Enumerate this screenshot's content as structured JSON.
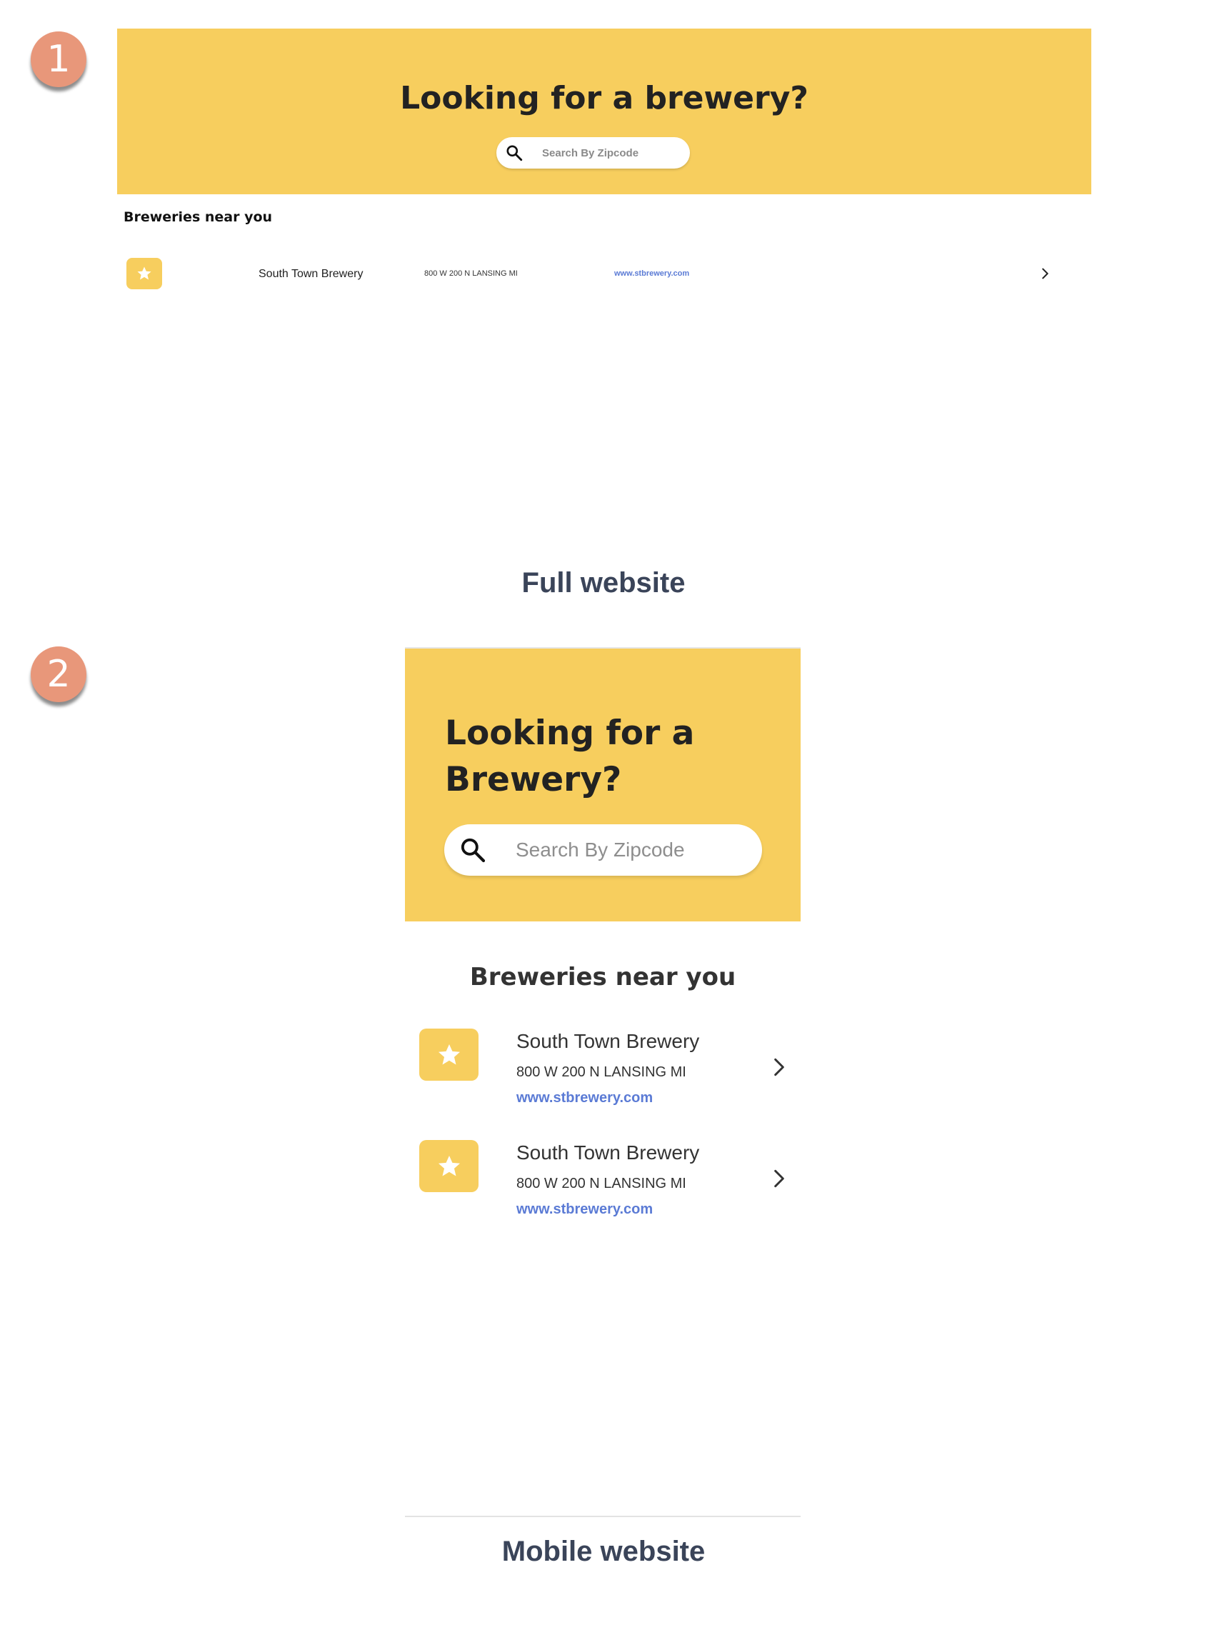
{
  "badges": {
    "first": "1",
    "second": "2"
  },
  "full_site": {
    "hero_title": "Looking for a brewery?",
    "search_placeholder": "Search By Zipcode",
    "section_title": "Breweries near you",
    "rows": [
      {
        "name": "South Town Brewery",
        "address": "800 W 200 N LANSING MI",
        "link": "www.stbrewery.com"
      }
    ],
    "label": "Full website"
  },
  "mobile_site": {
    "hero_title": "Looking for a Brewery?",
    "search_placeholder": "Search By Zipcode",
    "section_title": "Breweries near you",
    "rows": [
      {
        "name": "South Town Brewery",
        "address": "800 W 200 N LANSING MI",
        "link": "www.stbrewery.com"
      },
      {
        "name": "South Town Brewery",
        "address": "800 W 200 N LANSING MI",
        "link": "www.stbrewery.com"
      }
    ],
    "label": "Mobile website"
  },
  "colors": {
    "hero_yellow": "#f7ce5e",
    "badge_salmon": "#e8977a",
    "link_blue": "#5b7bd5",
    "label_slate": "#3a4459"
  },
  "icons": [
    "search-icon",
    "star-icon",
    "chevron-right-icon"
  ]
}
